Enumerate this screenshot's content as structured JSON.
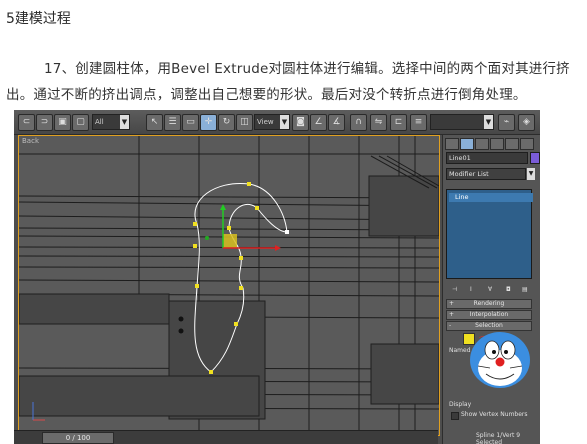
{
  "heading": "5建模过程",
  "paragraph": "17、创建圆柱体，用Bevel Extrude对圆柱体进行编辑。选择中间的两个面对其进行挤出。通过不断的挤出调点，调整出自己想要的形状。最后对没个转折点进行倒角处理。",
  "screenshot": {
    "toolbar": {
      "selection_filter": "All",
      "reference_coord": "View"
    },
    "viewport": {
      "label": "Back"
    },
    "timeline": {
      "frame_counter": "0 / 100"
    },
    "command_panel": {
      "object_name": "Line01",
      "modifier_list": "Modifier List",
      "stack_items": [
        "Line"
      ],
      "rollouts": [
        {
          "sign": "+",
          "label": "Rendering"
        },
        {
          "sign": "+",
          "label": "Interpolation"
        },
        {
          "sign": "-",
          "label": "Selection"
        }
      ],
      "named_selections_label": "Named Selections:",
      "display_label": "Display",
      "show_vertex_numbers": "Show Vertex Numbers",
      "status": "Spline 1/Vert 9 Selected"
    },
    "colors": {
      "viewport_border": "#e0a020",
      "stack_bg": "#2e5f8a",
      "spline": "#ffffff",
      "vertex": "#f0e020"
    }
  }
}
